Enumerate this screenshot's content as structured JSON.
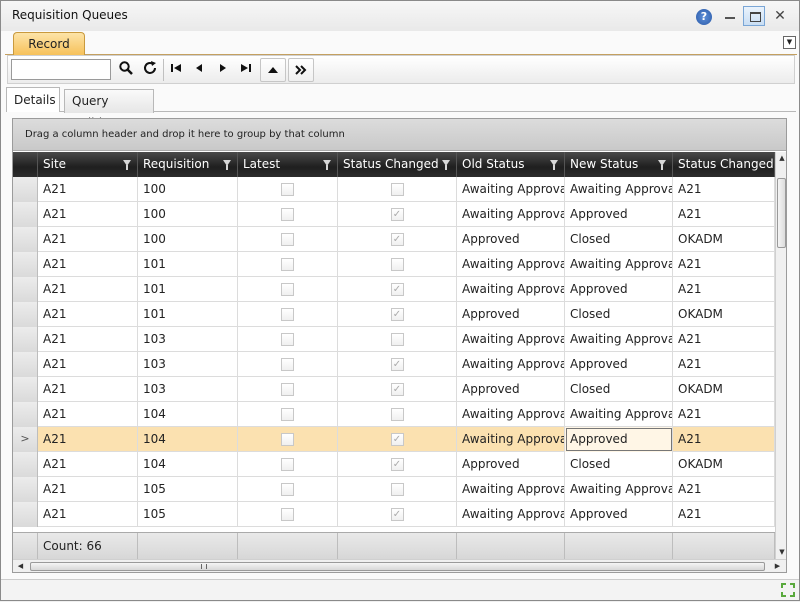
{
  "window": {
    "title": "Requisition Queues"
  },
  "icons": {
    "help": "help-icon",
    "minimize": "minimize-icon",
    "maximize": "maximize-icon",
    "close": "close-icon",
    "search": "search-icon",
    "refresh": "refresh-icon",
    "first": "first-record-icon",
    "prev": "previous-record-icon",
    "next": "next-record-icon",
    "last": "last-record-icon",
    "up": "up-icon",
    "more": "more-icon",
    "filter": "funnel-icon",
    "resize": "resize-grip-icon"
  },
  "colors": {
    "accent_tab": "#f6c15a",
    "selected_row": "#fbe1b0",
    "header_bg": "#2c2c2c"
  },
  "tabs": {
    "record": "Record",
    "menu_glyph": "▼"
  },
  "toolbar": {
    "search_value": "",
    "glyphs": {
      "search": "🔍",
      "refresh": "↻",
      "first": "⏮",
      "prev": "◀",
      "next": "▶",
      "last": "⏭",
      "up": "▲",
      "more": "»"
    }
  },
  "subtabs": {
    "details": "Details",
    "query_builder": "Query Builder"
  },
  "grid": {
    "group_hint": "Drag a column header and drop it here to group by that column",
    "columns": [
      "Site",
      "Requisition",
      "Latest",
      "Status Changed",
      "Old Status",
      "New Status",
      "Status Changed By"
    ],
    "rows": [
      {
        "site": "A21",
        "req": "100",
        "latest": false,
        "changed": false,
        "old": "Awaiting Approval",
        "new": "Awaiting Approval",
        "by": "A21"
      },
      {
        "site": "A21",
        "req": "100",
        "latest": false,
        "changed": true,
        "old": "Awaiting Approval",
        "new": "Approved",
        "by": "A21"
      },
      {
        "site": "A21",
        "req": "100",
        "latest": false,
        "changed": true,
        "old": "Approved",
        "new": "Closed",
        "by": "OKADM"
      },
      {
        "site": "A21",
        "req": "101",
        "latest": false,
        "changed": false,
        "old": "Awaiting Approval",
        "new": "Awaiting Approval",
        "by": "A21"
      },
      {
        "site": "A21",
        "req": "101",
        "latest": false,
        "changed": true,
        "old": "Awaiting Approval",
        "new": "Approved",
        "by": "A21"
      },
      {
        "site": "A21",
        "req": "101",
        "latest": false,
        "changed": true,
        "old": "Approved",
        "new": "Closed",
        "by": "OKADM"
      },
      {
        "site": "A21",
        "req": "103",
        "latest": false,
        "changed": false,
        "old": "Awaiting Approval",
        "new": "Awaiting Approval",
        "by": "A21"
      },
      {
        "site": "A21",
        "req": "103",
        "latest": false,
        "changed": true,
        "old": "Awaiting Approval",
        "new": "Approved",
        "by": "A21"
      },
      {
        "site": "A21",
        "req": "103",
        "latest": false,
        "changed": true,
        "old": "Approved",
        "new": "Closed",
        "by": "OKADM"
      },
      {
        "site": "A21",
        "req": "104",
        "latest": false,
        "changed": false,
        "old": "Awaiting Approval",
        "new": "Awaiting Approval",
        "by": "A21"
      },
      {
        "site": "A21",
        "req": "104",
        "latest": false,
        "changed": true,
        "old": "Awaiting Approval",
        "new": "Approved",
        "by": "A21",
        "selected": true
      },
      {
        "site": "A21",
        "req": "104",
        "latest": false,
        "changed": true,
        "old": "Approved",
        "new": "Closed",
        "by": "OKADM"
      },
      {
        "site": "A21",
        "req": "105",
        "latest": false,
        "changed": false,
        "old": "Awaiting Approval",
        "new": "Awaiting Approval",
        "by": "A21"
      },
      {
        "site": "A21",
        "req": "105",
        "latest": false,
        "changed": true,
        "old": "Awaiting Approval",
        "new": "Approved",
        "by": "A21"
      }
    ],
    "footer": {
      "count": "Count: 66"
    },
    "current_row_glyph": ">"
  }
}
